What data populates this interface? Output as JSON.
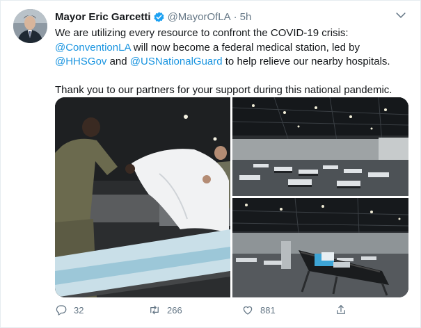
{
  "tweet": {
    "author_name": "Mayor Eric Garcetti",
    "handle": "@MayorOfLA",
    "separator": "·",
    "time": "5h",
    "text": {
      "l1": "We are utilizing every resource to confront the COVID-19 crisis:",
      "mention_convention": "@ConventionLA",
      "l2_rest": " will now become a federal medical station, led by",
      "mention_hhs": "@HHSGov",
      "and": " and ",
      "mention_guard": "@USNationalGuard",
      "l3_rest": " to help relieve our nearby hospitals.",
      "l4": "Thank you to our partners for your support during this national pandemic."
    }
  },
  "stats": {
    "replies": "32",
    "retweets": "266",
    "likes": "881"
  },
  "icons": {
    "verified": "verified-badge-icon",
    "menu": "chevron-down-icon",
    "reply": "reply-icon",
    "retweet": "retweet-icon",
    "like": "heart-icon",
    "share": "share-icon"
  },
  "colors": {
    "link": "#1b95e0",
    "secondary_text": "#657786",
    "verified": "#1da1f2"
  }
}
